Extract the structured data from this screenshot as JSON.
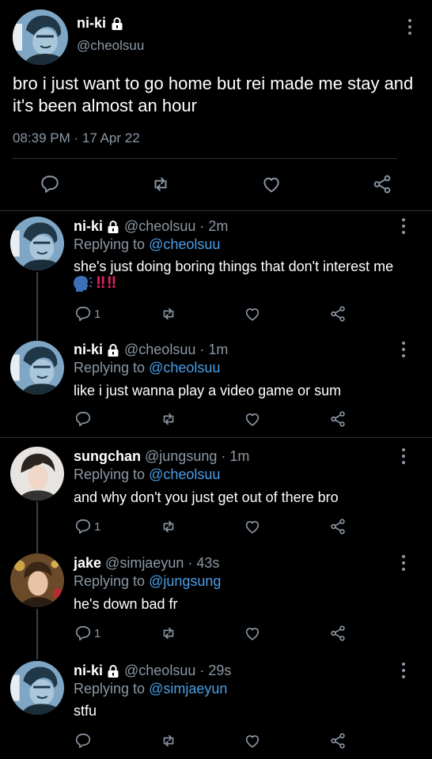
{
  "main_tweet": {
    "name": "ni-ki",
    "handle": "@cheolsuu",
    "text": "bro i just want to go home but rei made me stay and it's been almost an hour",
    "timestamp": "08:39 PM · 17 Apr 22"
  },
  "replies": [
    {
      "name": "ni-ki",
      "handle": "@cheolsuu · 2m",
      "replying_prefix": "Replying to",
      "replying_to": "@cheolsuu",
      "text": "she's just doing boring things that don't interest me",
      "reply_count": "1"
    },
    {
      "name": "ni-ki",
      "handle": "@cheolsuu · 1m",
      "replying_prefix": "Replying to",
      "replying_to": "@cheolsuu",
      "text": "like i just wanna play a video game or sum",
      "reply_count": ""
    },
    {
      "name": "sungchan",
      "handle": "@jungsung · 1m",
      "replying_prefix": "Replying to",
      "replying_to": "@cheolsuu",
      "text": "and why don't you just get out of there bro",
      "reply_count": "1"
    },
    {
      "name": "jake",
      "handle": "@simjaeyun · 43s",
      "replying_prefix": "Replying to",
      "replying_to": "@jungsung",
      "text": "he's down bad fr",
      "reply_count": "1"
    },
    {
      "name": "ni-ki",
      "handle": "@cheolsuu · 29s",
      "replying_prefix": "Replying to",
      "replying_to": "@simjaeyun",
      "text": "stfu",
      "reply_count": ""
    }
  ],
  "emoji": {
    "exclaim": "‼"
  },
  "colors": {
    "background": "#000000",
    "link": "#4a9ee6",
    "muted": "#8b98a5",
    "avatar_blue": "#7fa6c4"
  }
}
